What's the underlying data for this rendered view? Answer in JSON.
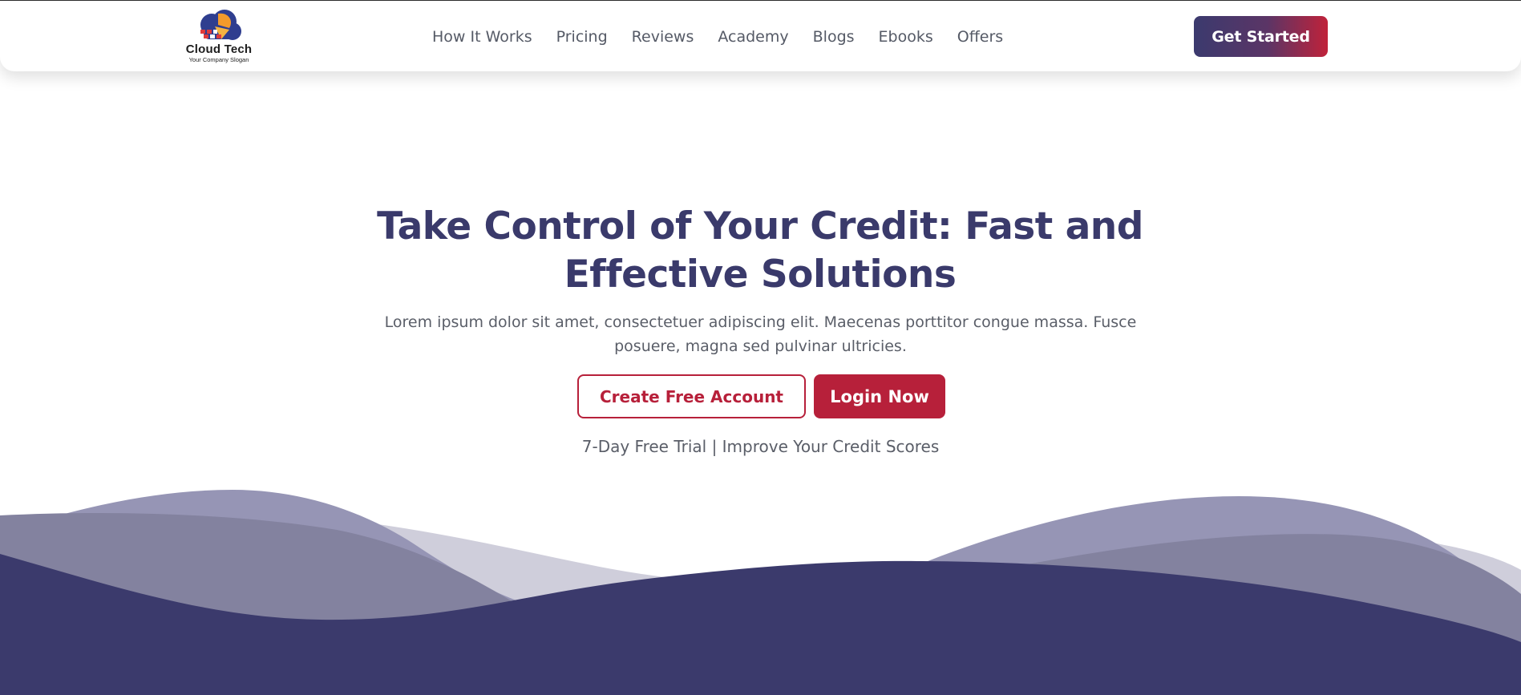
{
  "colors": {
    "brand_navy": "#3a3a6b",
    "accent_red": "#b7203a",
    "wave_dark": "#3b3a6c",
    "wave_mid": "#8b8aab",
    "wave_light": "#cfcedb"
  },
  "logo": {
    "name": "Cloud Tech",
    "slogan": "Your Company Slogan",
    "icon": "cloud-logo-icon"
  },
  "nav": {
    "items": [
      {
        "label": "How It Works"
      },
      {
        "label": "Pricing"
      },
      {
        "label": "Reviews"
      },
      {
        "label": "Academy"
      },
      {
        "label": "Blogs"
      },
      {
        "label": "Ebooks"
      },
      {
        "label": "Offers"
      }
    ]
  },
  "header": {
    "cta_label": "Get Started"
  },
  "hero": {
    "title": "Take Control of Your Credit: Fast and Effective Solutions",
    "subtitle": "Lorem ipsum dolor sit amet, consectetuer adipiscing elit. Maecenas porttitor congue massa. Fusce posuere, magna sed pulvinar ultricies.",
    "primary_button": "Create Free Account",
    "secondary_button": "Login Now",
    "trial_text": "7-Day Free Trial | Improve Your Credit Scores"
  }
}
